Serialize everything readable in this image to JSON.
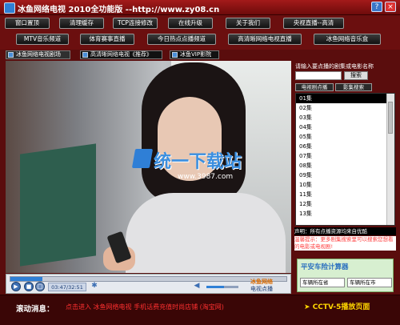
{
  "app": {
    "title": "冰鱼网络电视 2010全功能版 --http://www.zy08.cn",
    "window_buttons": [
      "?",
      "×"
    ]
  },
  "toolbar": {
    "row1": [
      "窗口置顶",
      "清理缓存",
      "TCP连接修改",
      "在线升级",
      "关于我们",
      "央视直播--高清"
    ],
    "row2": [
      "MTV音乐频道",
      "体育赛事直播",
      "今日热点点播频道",
      "高清晰网络电视直播",
      "冰鱼网络音乐盒"
    ]
  },
  "tabs": [
    "冰鱼网络电视剧场",
    "高清晰网络电视《推荐》",
    "冰鱼VIP影院"
  ],
  "video": {
    "watermark": "统一下载站",
    "watermark_sub": "www.3987.com"
  },
  "player": {
    "time": "03:47/32:51",
    "progress": 0.116,
    "volume": 0.55,
    "brand_line1": "冰鱼网络",
    "brand_line2": "电视点播"
  },
  "right_panel": {
    "prompt": "请输入要点播的剧集或电影名称",
    "search_value": "",
    "search_button": "搜索",
    "tabs": [
      "电视剧点播",
      "影集搜索"
    ],
    "episodes": [
      "01集",
      "02集",
      "03集",
      "04集",
      "05集",
      "06集",
      "07集",
      "08集",
      "09集",
      "10集",
      "11集",
      "12集",
      "13集"
    ],
    "selected_index": 0,
    "disclaimer": "声明：所有点播资源均来自优酷",
    "tip": "温馨提示：更多剧集搜索里可以搜索您想看的电影或电视剧!",
    "ad_title": "平安车险计算器",
    "ad_select_1": "车辆所在省",
    "ad_select_2": "车辆所在市"
  },
  "footer": {
    "label": "滚动消息：",
    "text": "点击进入 冰鱼网络电视 手机话费充值时尚店铺 (淘宝网)",
    "cctv_link": "CCTV-5播放页面"
  }
}
